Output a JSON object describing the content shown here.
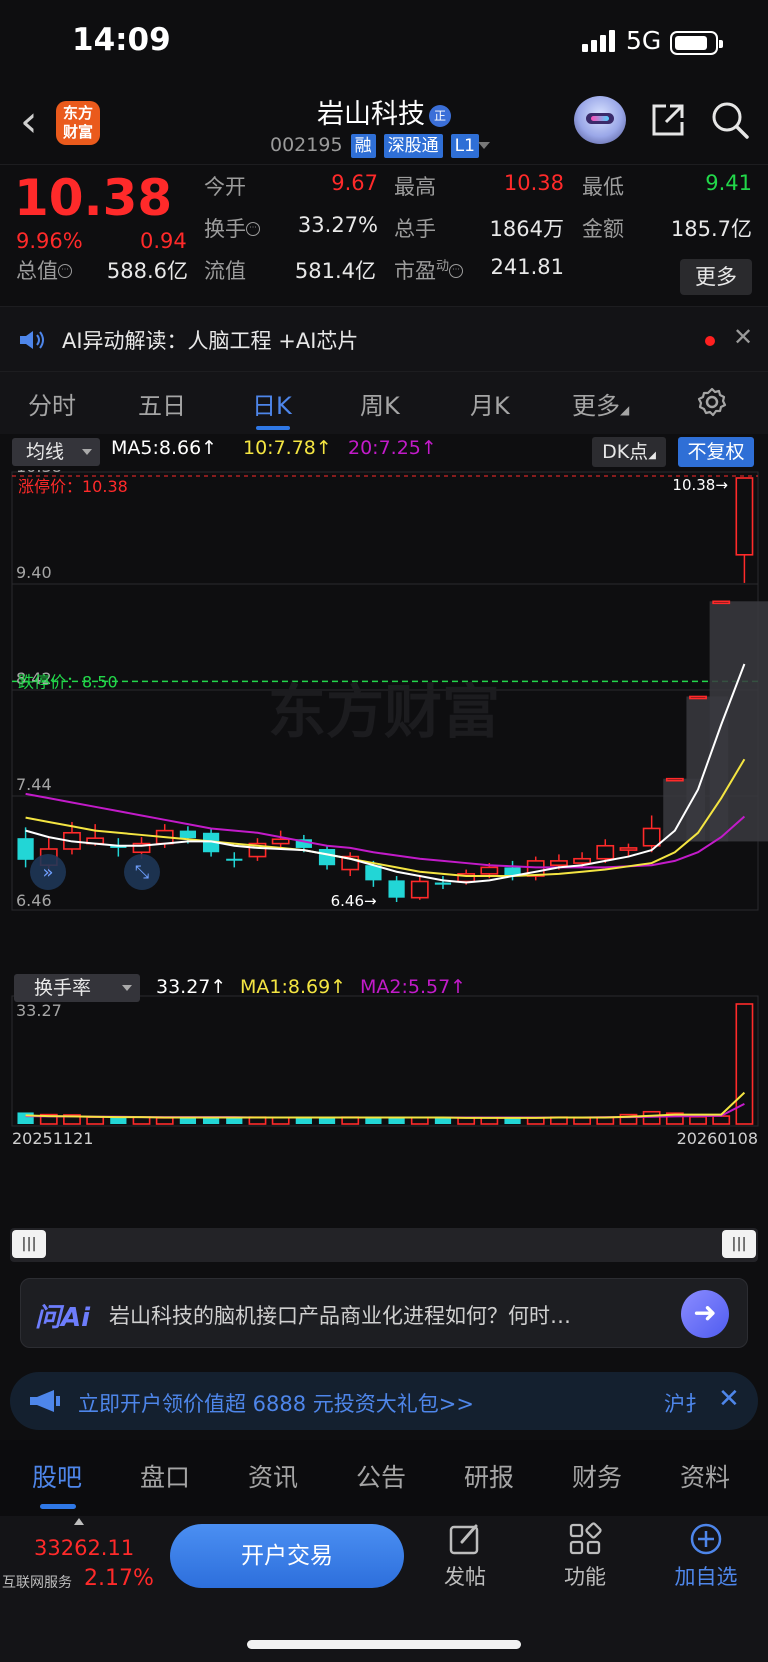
{
  "status_bar": {
    "time": "14:09",
    "network": "5G"
  },
  "header": {
    "app_logo": "东方\n财富",
    "stock_name": "岩山科技",
    "name_badge": "正",
    "code": "002195",
    "tags": [
      "融",
      "深股通",
      "L1"
    ]
  },
  "quote": {
    "price": "10.38",
    "change_pct": "9.96%",
    "change": "0.94",
    "fields": [
      {
        "label": "今开",
        "value": "9.67",
        "color": "#ff2a2a"
      },
      {
        "label": "最高",
        "value": "10.38",
        "color": "#ff2a2a"
      },
      {
        "label": "最低",
        "value": "9.41",
        "color": "#22d84a"
      },
      {
        "label": "换手",
        "value": "33.27%",
        "color": "#e8e8e8"
      },
      {
        "label": "总手",
        "value": "1864万",
        "color": "#e8e8e8"
      },
      {
        "label": "金额",
        "value": "185.7亿",
        "color": "#e8e8e8"
      },
      {
        "label": "总值",
        "value": "588.6亿",
        "color": "#e8e8e8"
      },
      {
        "label": "流值",
        "value": "581.4亿",
        "color": "#e8e8e8"
      },
      {
        "label": "市盈",
        "value": "241.81",
        "color": "#e8e8e8"
      }
    ],
    "pe_sup": "动",
    "more_label": "更多"
  },
  "ai_notice": {
    "text": "AI异动解读：人脑工程 +AI芯片"
  },
  "period_tabs": [
    "分时",
    "五日",
    "日K",
    "周K",
    "月K",
    "更多"
  ],
  "indicator_bar": {
    "ma_select": "均线",
    "ma5": "MA5:8.66↑",
    "ma10": "10:7.78↑",
    "ma20": "20:7.25↑",
    "dk_label": "DK点",
    "fq_label": "不复权"
  },
  "kline": {
    "y_labels": [
      "10.38",
      "9.40",
      "8.42",
      "7.44",
      "6.46"
    ],
    "limit_up_label": "涨停价：10.38",
    "limit_down_label": "跌停价：8.50",
    "high_marker": "10.38→",
    "low_marker": "6.46→",
    "watermark": "东方财富"
  },
  "volume": {
    "select": "换手率",
    "value": "33.27↑",
    "ma1": "MA1:8.69↑",
    "ma2": "MA2:5.57↑",
    "top_label": "33.27",
    "date_start": "20251121",
    "date_end": "20260108"
  },
  "chart_data": {
    "type": "candlestick",
    "y_range": [
      6.46,
      10.38
    ],
    "candles": [
      {
        "o": 6.85,
        "c": 7.05,
        "h": 7.15,
        "l": 6.78,
        "up": false
      },
      {
        "o": 6.8,
        "c": 6.95,
        "h": 7.05,
        "l": 6.7,
        "up": true
      },
      {
        "o": 6.95,
        "c": 7.1,
        "h": 7.2,
        "l": 6.9,
        "up": true
      },
      {
        "o": 7.05,
        "c": 7.0,
        "h": 7.18,
        "l": 6.98,
        "up": true
      },
      {
        "o": 6.98,
        "c": 6.96,
        "h": 7.05,
        "l": 6.88,
        "up": false
      },
      {
        "o": 6.92,
        "c": 7.0,
        "h": 7.06,
        "l": 6.86,
        "up": true
      },
      {
        "o": 7.0,
        "c": 7.12,
        "h": 7.18,
        "l": 6.96,
        "up": true
      },
      {
        "o": 7.12,
        "c": 7.05,
        "h": 7.16,
        "l": 7.0,
        "up": false
      },
      {
        "o": 7.1,
        "c": 6.92,
        "h": 7.14,
        "l": 6.88,
        "up": false
      },
      {
        "o": 6.86,
        "c": 6.86,
        "h": 6.92,
        "l": 6.78,
        "up": false
      },
      {
        "o": 6.88,
        "c": 7.0,
        "h": 7.05,
        "l": 6.84,
        "up": true
      },
      {
        "o": 7.0,
        "c": 7.04,
        "h": 7.12,
        "l": 6.96,
        "up": true
      },
      {
        "o": 7.04,
        "c": 6.96,
        "h": 7.08,
        "l": 6.92,
        "up": false
      },
      {
        "o": 6.95,
        "c": 6.8,
        "h": 6.98,
        "l": 6.76,
        "up": false
      },
      {
        "o": 6.76,
        "c": 6.88,
        "h": 6.92,
        "l": 6.7,
        "up": true
      },
      {
        "o": 6.8,
        "c": 6.66,
        "h": 6.84,
        "l": 6.6,
        "up": false
      },
      {
        "o": 6.66,
        "c": 6.5,
        "h": 6.7,
        "l": 6.46,
        "up": false
      },
      {
        "o": 6.5,
        "c": 6.65,
        "h": 6.7,
        "l": 6.48,
        "up": true
      },
      {
        "o": 6.62,
        "c": 6.64,
        "h": 6.7,
        "l": 6.58,
        "up": false
      },
      {
        "o": 6.65,
        "c": 6.72,
        "h": 6.76,
        "l": 6.62,
        "up": true
      },
      {
        "o": 6.72,
        "c": 6.78,
        "h": 6.82,
        "l": 6.68,
        "up": true
      },
      {
        "o": 6.78,
        "c": 6.7,
        "h": 6.84,
        "l": 6.66,
        "up": false
      },
      {
        "o": 6.7,
        "c": 6.84,
        "h": 6.88,
        "l": 6.66,
        "up": true
      },
      {
        "o": 6.8,
        "c": 6.84,
        "h": 6.9,
        "l": 6.76,
        "up": true
      },
      {
        "o": 6.82,
        "c": 6.86,
        "h": 6.92,
        "l": 6.78,
        "up": true
      },
      {
        "o": 6.86,
        "c": 6.98,
        "h": 7.04,
        "l": 6.82,
        "up": true
      },
      {
        "o": 6.94,
        "c": 6.96,
        "h": 7.0,
        "l": 6.88,
        "up": true
      },
      {
        "o": 6.98,
        "c": 7.14,
        "h": 7.26,
        "l": 6.92,
        "up": true
      },
      {
        "o": 7.6,
        "c": 7.6,
        "h": 7.6,
        "l": 7.6,
        "up": true
      },
      {
        "o": 8.36,
        "c": 8.36,
        "h": 8.36,
        "l": 8.36,
        "up": true
      },
      {
        "o": 9.24,
        "c": 9.24,
        "h": 9.24,
        "l": 9.24,
        "up": true
      },
      {
        "o": 9.67,
        "c": 10.38,
        "h": 10.38,
        "l": 9.41,
        "up": true
      }
    ],
    "ma5": [
      7.12,
      7.06,
      7.02,
      7.0,
      6.98,
      6.98,
      7.0,
      7.02,
      7.02,
      6.98,
      6.96,
      6.95,
      6.94,
      6.9,
      6.86,
      6.8,
      6.74,
      6.7,
      6.66,
      6.64,
      6.66,
      6.7,
      6.74,
      6.78,
      6.8,
      6.84,
      6.88,
      6.94,
      7.12,
      7.5,
      8.1,
      8.66
    ],
    "ma10": [
      7.24,
      7.2,
      7.16,
      7.12,
      7.1,
      7.08,
      7.06,
      7.04,
      7.02,
      7.0,
      6.98,
      6.96,
      6.94,
      6.9,
      6.86,
      6.82,
      6.78,
      6.74,
      6.72,
      6.7,
      6.7,
      6.7,
      6.71,
      6.72,
      6.74,
      6.76,
      6.79,
      6.82,
      6.92,
      7.1,
      7.42,
      7.78
    ],
    "ma20": [
      7.46,
      7.42,
      7.38,
      7.34,
      7.3,
      7.26,
      7.22,
      7.18,
      7.14,
      7.12,
      7.1,
      7.06,
      7.02,
      6.98,
      6.96,
      6.92,
      6.89,
      6.86,
      6.84,
      6.82,
      6.8,
      6.79,
      6.78,
      6.78,
      6.78,
      6.78,
      6.79,
      6.8,
      6.84,
      6.92,
      7.06,
      7.25
    ],
    "turnover": [
      3.2,
      2.6,
      2.5,
      1.9,
      1.8,
      1.9,
      1.7,
      1.8,
      1.9,
      1.7,
      1.9,
      1.8,
      1.7,
      1.8,
      1.9,
      1.8,
      1.7,
      1.8,
      1.7,
      1.7,
      1.7,
      1.6,
      1.7,
      1.9,
      1.7,
      1.8,
      2.6,
      3.4,
      3.0,
      2.0,
      2.2,
      33.27
    ],
    "turnover_ma1": [
      2.4,
      2.2,
      2.1,
      2.0,
      1.9,
      1.9,
      1.8,
      1.8,
      1.8,
      1.8,
      1.8,
      1.8,
      1.8,
      1.8,
      1.8,
      1.8,
      1.8,
      1.8,
      1.8,
      1.7,
      1.7,
      1.7,
      1.7,
      1.8,
      1.8,
      1.8,
      2.0,
      2.3,
      2.6,
      2.6,
      2.6,
      8.69
    ],
    "turnover_ma2": [
      2.2,
      2.1,
      2.1,
      2.0,
      2.0,
      1.9,
      1.9,
      1.9,
      1.9,
      1.9,
      1.8,
      1.8,
      1.8,
      1.8,
      1.8,
      1.8,
      1.8,
      1.8,
      1.8,
      1.8,
      1.8,
      1.8,
      1.8,
      1.8,
      1.8,
      1.9,
      1.9,
      2.0,
      2.1,
      2.2,
      2.3,
      5.57
    ],
    "turnover_max": 33.27
  },
  "ask_ai": {
    "brand": "问Ai",
    "question": "岩山科技的脑机接口产品商业化进程如何？何时…"
  },
  "promo": {
    "text": "立即开户领价值超 6888 元投资大礼包>>",
    "tail": "沪扌"
  },
  "bottom_tabs": [
    "股吧",
    "盘口",
    "资讯",
    "公告",
    "研报",
    "财务",
    "资料"
  ],
  "bottom_bar": {
    "index_value": "33262.11",
    "index_name": "互联网服务",
    "index_pct": "2.17%",
    "trade_label": "开户交易",
    "post_label": "发帖",
    "func_label": "功能",
    "watch_label": "加自选"
  },
  "colors": {
    "up": "#ff2a2a",
    "down": "#22d6d6",
    "accent": "#2f78e6",
    "ma5": "#ffffff",
    "ma10": "#f4e542",
    "ma20": "#c21bc9"
  }
}
